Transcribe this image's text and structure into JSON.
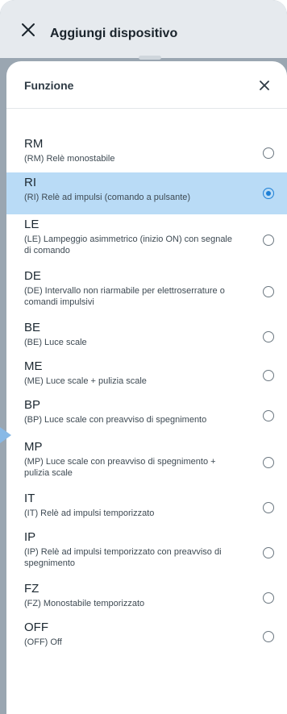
{
  "header": {
    "title": "Aggiungi dispositivo"
  },
  "sheet": {
    "title": "Funzione"
  },
  "options": [
    {
      "code": "RM",
      "desc": "(RM) Relè monostabile",
      "selected": false
    },
    {
      "code": "RI",
      "desc": "(RI) Relè ad impulsi (comando a pulsante)",
      "selected": true
    },
    {
      "code": "LE",
      "desc": "(LE) Lampeggio asimmetrico (inizio ON) con segnale di comando",
      "selected": false
    },
    {
      "code": "DE",
      "desc": "(DE) Intervallo non riarmabile per elettroserrature o comandi impulsivi",
      "selected": false
    },
    {
      "code": "BE",
      "desc": "(BE) Luce scale",
      "selected": false
    },
    {
      "code": "ME",
      "desc": "(ME) Luce scale + pulizia scale",
      "selected": false
    },
    {
      "code": "BP",
      "desc": "(BP) Luce scale con preavviso di spegnimento",
      "selected": false
    },
    {
      "code": "MP",
      "desc": "(MP) Luce scale con preavviso di spegnimento + pulizia scale",
      "selected": false
    },
    {
      "code": "IT",
      "desc": "(IT) Relè ad impulsi temporizzato",
      "selected": false
    },
    {
      "code": "IP",
      "desc": "(IP) Relè ad impulsi temporizzato con preavviso di spegnimento",
      "selected": false
    },
    {
      "code": "FZ",
      "desc": "(FZ) Monostabile temporizzato",
      "selected": false
    },
    {
      "code": "OFF",
      "desc": "(OFF) Off",
      "selected": false
    }
  ],
  "icons": {
    "header_close": "close-icon",
    "sheet_close": "close-icon",
    "radio": "radio-button"
  },
  "colors": {
    "selected_row": "#b9dbf6",
    "accent": "#1d7fd6",
    "backdrop": "#9aa6b1"
  }
}
